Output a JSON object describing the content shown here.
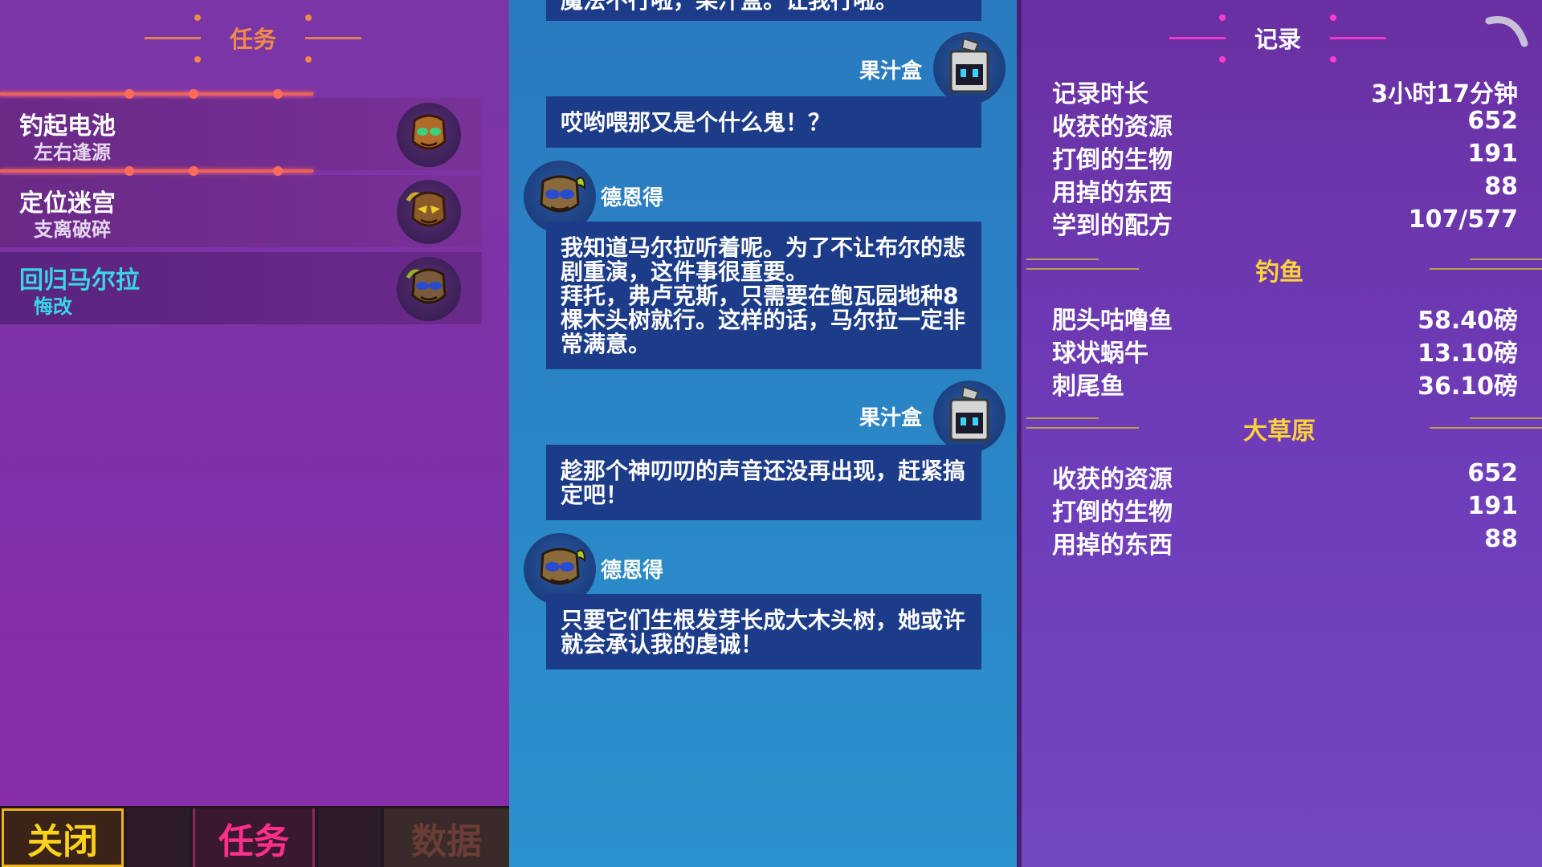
{
  "quests": {
    "title": "任务",
    "items": [
      {
        "name": "钓起电池",
        "sub": "左右逢源",
        "active": false
      },
      {
        "name": "定位迷宫",
        "sub": "支离破碎",
        "active": false
      },
      {
        "name": "回归马尔拉",
        "sub": "悔改",
        "active": true
      }
    ]
  },
  "tabs": {
    "close": "关闭",
    "quest": "任务",
    "data": "数据"
  },
  "dialogue": {
    "top_partial": "魔法不行啦，果汁盒。让我行啦。",
    "messages": [
      {
        "speaker": "果汁盒",
        "side": "right",
        "text": "哎哟喂那又是个什么鬼！？"
      },
      {
        "speaker": "德恩得",
        "side": "left",
        "text": "我知道马尔拉听着呢。为了不让布尔的悲剧重演，这件事很重要。\n拜托，弗卢克斯，只需要在鲍瓦园地种8棵木头树就行。这样的话，马尔拉一定非常满意。"
      },
      {
        "speaker": "果汁盒",
        "side": "right",
        "text": "趁那个神叨叨的声音还没再出现，赶紧搞定吧！"
      },
      {
        "speaker": "德恩得",
        "side": "left",
        "text": "只要它们生根发芽长成大木头树，她或许就会承认我的虔诚！"
      }
    ]
  },
  "record": {
    "title": "记录",
    "general": [
      {
        "label": "记录时长",
        "value": "3小时17分钟"
      },
      {
        "label": "收获的资源",
        "value": "652"
      },
      {
        "label": "打倒的生物",
        "value": "191"
      },
      {
        "label": "用掉的东西",
        "value": "88"
      },
      {
        "label": "学到的配方",
        "value": "107/577"
      }
    ],
    "fishing_title": "钓鱼",
    "fishing": [
      {
        "label": "肥头咕噜鱼",
        "value": "58.40磅"
      },
      {
        "label": "球状蜗牛",
        "value": "13.10磅"
      },
      {
        "label": "刺尾鱼",
        "value": "36.10磅"
      }
    ],
    "grassland_title": "大草原",
    "grassland": [
      {
        "label": "收获的资源",
        "value": "652"
      },
      {
        "label": "打倒的生物",
        "value": "191"
      },
      {
        "label": "用掉的东西",
        "value": "88"
      }
    ]
  },
  "colors": {
    "accent_quest": "#f08a4a",
    "active_quest": "#39d6e6",
    "section_title": "#ffd23a",
    "close_tab": "#ffd21a",
    "quest_tab": "#ff2f8a"
  },
  "icons": [
    "mask-portrait-icon",
    "robot-juicebox-icon",
    "loading-spinner-icon"
  ]
}
